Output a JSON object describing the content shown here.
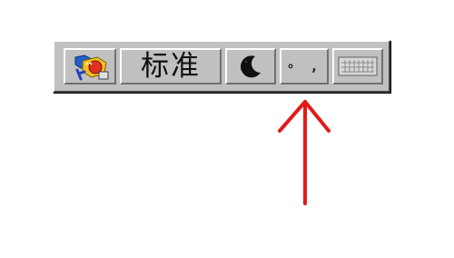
{
  "ime_toolbar": {
    "logo_icon": "ime-logo-icon",
    "mode_label": "标准",
    "full_half_width_icon": "moon-icon",
    "punctuation_glyph": "∘ ,",
    "soft_keyboard_icon": "keyboard-icon"
  },
  "annotation": {
    "arrow_icon": "red-arrow-icon",
    "arrow_color": "#e21a1a"
  }
}
